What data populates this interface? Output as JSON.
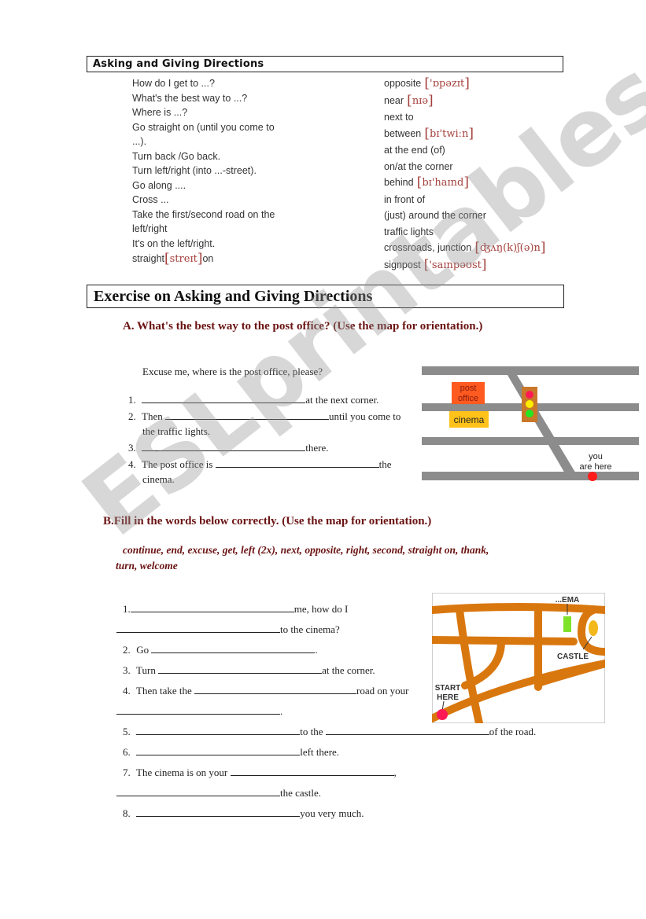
{
  "reference": {
    "title": "Asking and Giving Directions",
    "phrases": [
      "How do I get to ...?",
      "What's the best way to ...?",
      "Where is ...?",
      "Go straight on (until you come to",
      "...).",
      "Turn back /Go back.",
      "Turn left/right (into ...-street).",
      "Go along ....",
      "Cross ...",
      "Take the first/second road on the",
      "left/right",
      "It's on the left/right."
    ],
    "straight_on": {
      "word": "straight",
      "phonetic": "streɪt",
      "suffix": "on"
    },
    "vocabulary": [
      {
        "word": "opposite",
        "phonetic": "'ɒpəzɪt"
      },
      {
        "word": "near",
        "phonetic": "nɪə"
      },
      {
        "word": "next to",
        "phonetic": ""
      },
      {
        "word": "between",
        "phonetic": "bɪ'twiːn"
      },
      {
        "word": "at the end (of)",
        "phonetic": ""
      },
      {
        "word": "on/at the corner",
        "phonetic": ""
      },
      {
        "word": "behind",
        "phonetic": "bɪ'haɪnd"
      },
      {
        "word": "in front of",
        "phonetic": ""
      },
      {
        "word": "(just) around the corner",
        "phonetic": ""
      },
      {
        "word": "traffic lights",
        "phonetic": ""
      },
      {
        "word": "crossroads, junction",
        "phonetic": "ʤʌŋ(k)ʃ(ə)n"
      },
      {
        "word": "signpost",
        "phonetic": "'saɪnpəʊst"
      }
    ]
  },
  "exercise": {
    "title": "Exercise on Asking and Giving Directions",
    "partA": {
      "heading": "A.  What's the best way to the post office? (Use the map for orientation.)",
      "prompt": "Excuse me, where is the post office, please?",
      "items": [
        {
          "n": "1.",
          "before": "",
          "after": "at the next corner."
        },
        {
          "n": "2.",
          "before": "Then",
          "after": "until you come to",
          "cont": "the traffic lights."
        },
        {
          "n": "3.",
          "before": "",
          "after": "there."
        },
        {
          "n": "4.",
          "before": "The post office is",
          "after": "the",
          "cont": "cinema."
        }
      ],
      "map": {
        "post_office": "post office",
        "post_office_l1": "post",
        "post_office_l2": "office",
        "cinema": "cinema",
        "you_l1": "you",
        "you_l2": "are here",
        "colors": {
          "road": "#8c8c8c",
          "post_office": "#ff5a1f",
          "cinema": "#ffc21a",
          "traffic_light_box": "#c9782a",
          "red": "#ff1a55",
          "yellow": "#ffee00",
          "green": "#22e61f",
          "marker": "#ff1a1a"
        }
      }
    },
    "partB": {
      "heading": "B.Fill in the words below correctly. (Use the map for orientation.)",
      "words_l1": "continue, end, excuse, get, left (2x), next, opposite, right, second, straight on, thank,",
      "words_l2": "turn, welcome",
      "items": {
        "i1": {
          "n": "1.",
          "after": "me, how do I",
          "line2_after": "to the cinema?"
        },
        "i2": {
          "n": "2.",
          "before": "Go",
          "after": "."
        },
        "i3": {
          "n": "3.",
          "before": "Turn",
          "after": "at the corner."
        },
        "i4": {
          "n": "4.",
          "before": "Then take the",
          "after": "road on your",
          "line2_after": "."
        },
        "i5": {
          "n": "5.",
          "mid": "to the",
          "after": "of the road."
        },
        "i6": {
          "n": "6.",
          "after": "left there."
        },
        "i7": {
          "n": "7.",
          "before": "The cinema is on your",
          "after": ",",
          "line2_after": "the castle."
        },
        "i8": {
          "n": "8.",
          "after": "you very much."
        }
      },
      "map": {
        "cinema_label": "...EMA",
        "castle_label": "CASTLE",
        "start_l1": "START",
        "start_l2": "HERE",
        "colors": {
          "road": "#d9770f",
          "cinema": "#7fe22a",
          "castle": "#f2b81c",
          "start": "#ff1a55"
        }
      }
    }
  },
  "watermark": "ESLprintables.com"
}
